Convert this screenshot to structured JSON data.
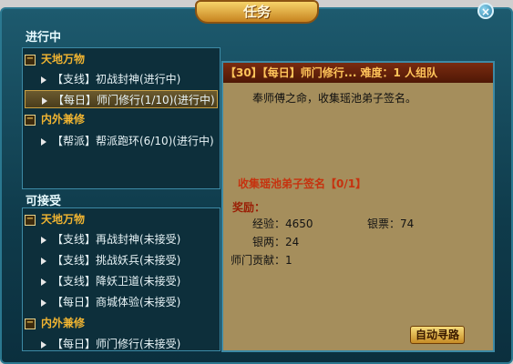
{
  "window": {
    "title": "任务",
    "close_icon": "close-icon"
  },
  "in_progress": {
    "heading": "进行中",
    "items": [
      {
        "kind": "category",
        "label": "天地万物"
      },
      {
        "kind": "quest",
        "label": "【支线】初战封神(进行中)"
      },
      {
        "kind": "quest",
        "label": "【每日】师门修行(1/10)(进行中)",
        "selected": true
      },
      {
        "kind": "category",
        "label": "内外兼修"
      },
      {
        "kind": "quest",
        "label": "【帮派】帮派跑环(6/10)(进行中)"
      }
    ]
  },
  "available": {
    "heading": "可接受",
    "items": [
      {
        "kind": "category",
        "label": "天地万物"
      },
      {
        "kind": "quest",
        "label": "【支线】再战封神(未接受)"
      },
      {
        "kind": "quest",
        "label": "【支线】挑战妖兵(未接受)"
      },
      {
        "kind": "quest",
        "label": "【支线】降妖卫道(未接受)"
      },
      {
        "kind": "quest",
        "label": "【每日】商城体验(未接受)"
      },
      {
        "kind": "category",
        "label": "内外兼修"
      },
      {
        "kind": "quest",
        "label": "【每日】师门修行(未接受)"
      }
    ]
  },
  "detail": {
    "header": "【30】【每日】师门修行...  难度：1 人组队",
    "description": "奉师傅之命，收集瑶池弟子签名。",
    "goal": "收集瑶池弟子签名【0/1】",
    "reward_title": "奖励：",
    "rewards": {
      "exp": "经验：4650",
      "silver_note": "银票：74",
      "silver": "银两：24",
      "contribution": "师门贡献：1"
    }
  },
  "auto_button": {
    "label": "自动寻路"
  },
  "colors": {
    "frame": "#1d5a6e",
    "category": "#f0b431",
    "detail_bg": "#a58e5c",
    "header_bg": "#7a2b10"
  }
}
